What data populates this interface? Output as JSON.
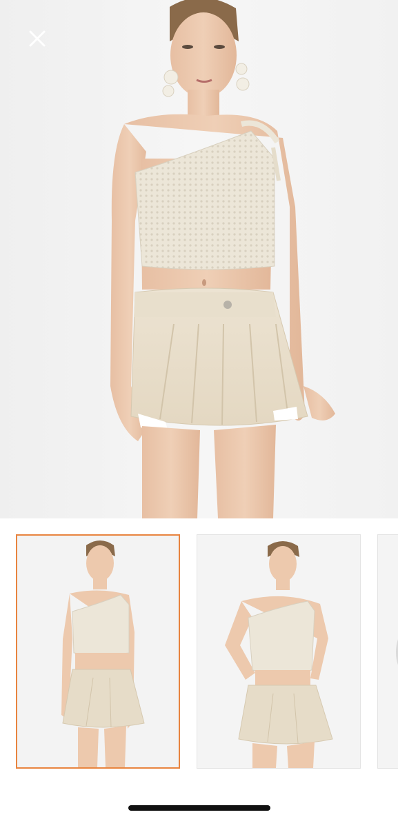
{
  "viewer": {
    "close_icon": "close-icon",
    "main_image": "product-photo-model-crochet-top-pleated-skirt",
    "selected_index": 0
  },
  "thumbnails": [
    {
      "name": "thumbnail-1",
      "selected": true
    },
    {
      "name": "thumbnail-2",
      "selected": false
    },
    {
      "name": "thumbnail-3",
      "selected": false
    }
  ],
  "colors": {
    "selected_border": "#e8843f",
    "background": "#ffffff",
    "home_indicator": "#111111"
  }
}
